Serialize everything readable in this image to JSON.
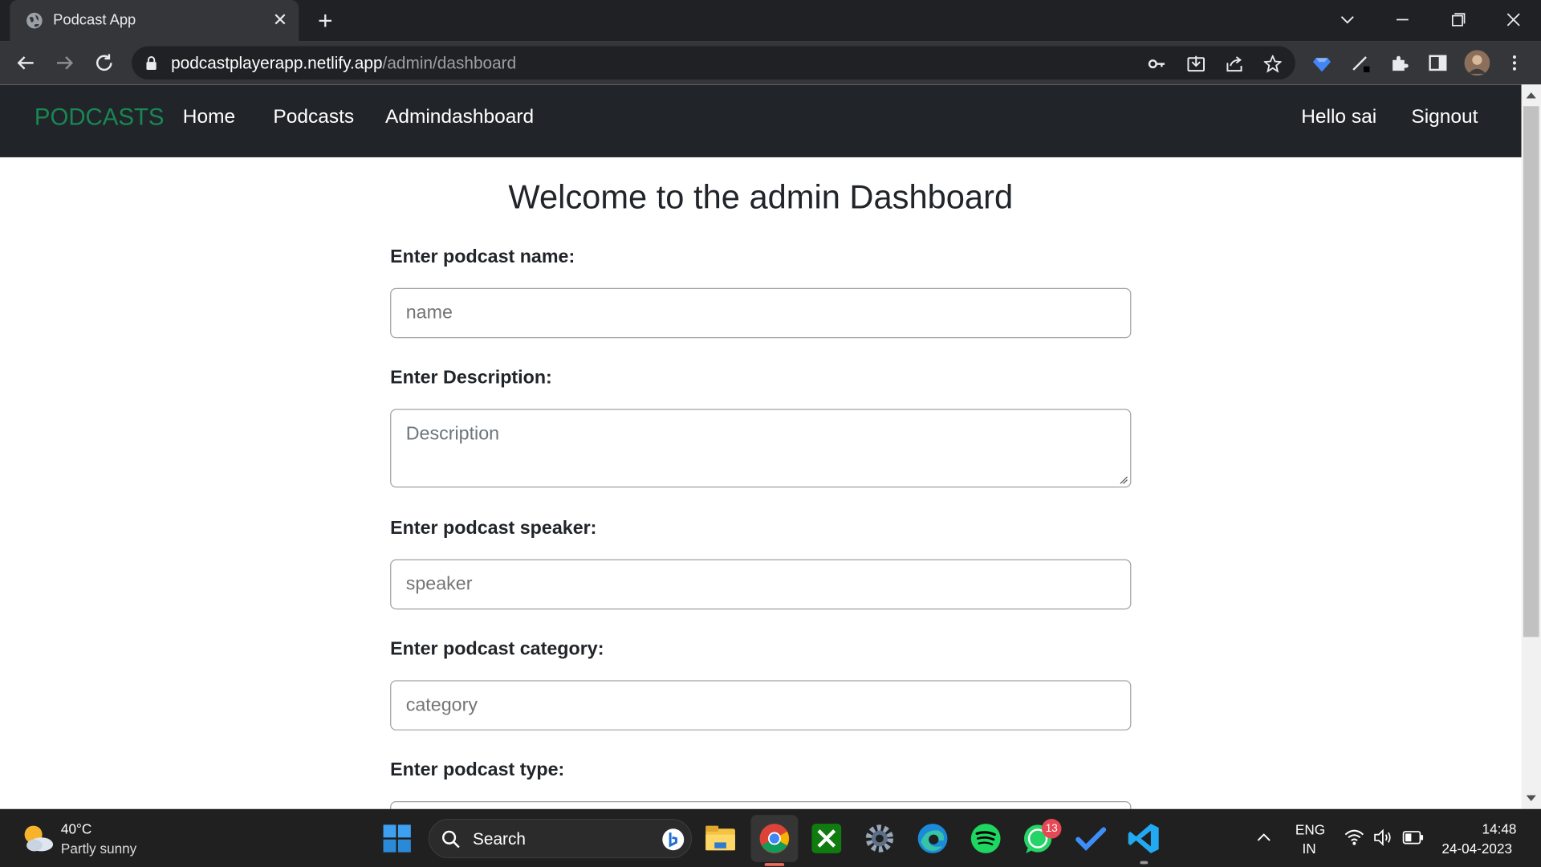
{
  "browser": {
    "tab_title": "Podcast App",
    "url_host": "podcastplayerapp.netlify.app",
    "url_path": "/admin/dashboard"
  },
  "navbar": {
    "brand": "PODCASTS",
    "links": [
      "Home",
      "Podcasts",
      "Admindashboard"
    ],
    "greeting": "Hello sai",
    "signout": "Signout"
  },
  "main": {
    "title": "Welcome to the admin Dashboard",
    "fields": [
      {
        "label": "Enter podcast name:",
        "placeholder": "name"
      },
      {
        "label": "Enter Description:",
        "placeholder": "Description"
      },
      {
        "label": "Enter podcast speaker:",
        "placeholder": "speaker"
      },
      {
        "label": "Enter podcast category:",
        "placeholder": "category"
      },
      {
        "label": "Enter podcast type:",
        "placeholder": ""
      }
    ]
  },
  "taskbar": {
    "weather_temp": "40°C",
    "weather_desc": "Partly sunny",
    "search_label": "Search",
    "whatsapp_badge": "13",
    "lang_primary": "ENG",
    "lang_secondary": "IN",
    "time": "14:48",
    "date": "24-04-2023"
  },
  "colors": {
    "brand": "#198754",
    "navbar_bg": "#212529",
    "browser_bg": "#35363a",
    "taskbar_bg": "#202020"
  }
}
